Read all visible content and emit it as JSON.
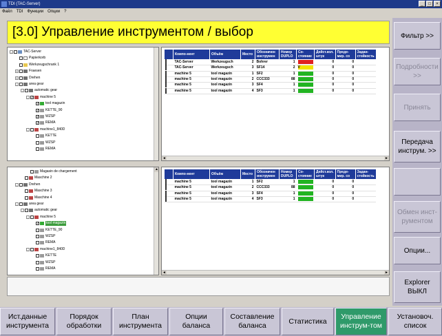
{
  "window": {
    "title": "TDI  (TAC-Server)"
  },
  "menu": [
    "Файл",
    "TDI",
    "Функции",
    "Опции",
    "?"
  ],
  "header": {
    "title": "[3.0] Управление инструментом / выбор"
  },
  "right_buttons": [
    {
      "label": "Фильтр >>",
      "enabled": true
    },
    {
      "label": "Подробности\n>>",
      "enabled": false
    },
    {
      "label": "Принять",
      "enabled": false
    },
    {
      "label": "Передача\nинструм. >>",
      "enabled": true
    },
    {
      "label": "",
      "enabled": false
    },
    {
      "label": "Обмен инст-\nрументом",
      "enabled": false
    },
    {
      "label": "Опции...",
      "enabled": true
    },
    {
      "label": "Explorer\nВЫКЛ",
      "enabled": true
    }
  ],
  "tree_top": [
    {
      "indent": 0,
      "exp": "-",
      "chk": "",
      "icon": "server",
      "label": "TAC-Server"
    },
    {
      "indent": 1,
      "exp": "",
      "chk": "",
      "icon": "doc",
      "label": "Papierkorb"
    },
    {
      "indent": 1,
      "exp": "",
      "chk": "",
      "icon": "folder",
      "label": "Werkzeugschrank 1"
    },
    {
      "indent": 1,
      "exp": "+",
      "chk": "",
      "icon": "gear",
      "label": "Fraesen"
    },
    {
      "indent": 1,
      "exp": "+",
      "chk": "",
      "icon": "gear",
      "label": "Drehen"
    },
    {
      "indent": 1,
      "exp": "-",
      "chk": "",
      "icon": "gear",
      "label": "area gear"
    },
    {
      "indent": 2,
      "exp": "-",
      "chk": "",
      "icon": "gear",
      "label": "automatic gear"
    },
    {
      "indent": 3,
      "exp": "-",
      "chk": "✓",
      "icon": "machine",
      "label": "machine 5"
    },
    {
      "indent": 4,
      "exp": "",
      "chk": "✓",
      "icon": "green",
      "label": "tool magazin"
    },
    {
      "indent": 4,
      "exp": "",
      "chk": "✓",
      "icon": "grey",
      "label": "KETTE_90"
    },
    {
      "indent": 4,
      "exp": "",
      "chk": "✓",
      "icon": "grey",
      "label": "WZSP"
    },
    {
      "indent": 4,
      "exp": "",
      "chk": "✓",
      "icon": "grey",
      "label": "REMA"
    },
    {
      "indent": 3,
      "exp": "-",
      "chk": "",
      "icon": "machine",
      "label": "machine1_840D"
    },
    {
      "indent": 4,
      "exp": "",
      "chk": "",
      "icon": "grey",
      "label": "KETTE"
    },
    {
      "indent": 4,
      "exp": "",
      "chk": "",
      "icon": "grey",
      "label": "WZSP"
    },
    {
      "indent": 4,
      "exp": "",
      "chk": "",
      "icon": "grey",
      "label": "REMA"
    }
  ],
  "tree_bottom": [
    {
      "indent": 3,
      "exp": "",
      "chk": "",
      "icon": "grey",
      "label": "Magasin de chargement"
    },
    {
      "indent": 2,
      "exp": "",
      "chk": "",
      "icon": "machine",
      "label": "Maschine 2"
    },
    {
      "indent": 1,
      "exp": "-",
      "chk": "",
      "icon": "gear",
      "label": "Drehen"
    },
    {
      "indent": 2,
      "exp": "",
      "chk": "",
      "icon": "machine",
      "label": "Maschine 3"
    },
    {
      "indent": 2,
      "exp": "",
      "chk": "",
      "icon": "machine",
      "label": "Maschine 4"
    },
    {
      "indent": 1,
      "exp": "-",
      "chk": "",
      "icon": "gear",
      "label": "area gear"
    },
    {
      "indent": 2,
      "exp": "-",
      "chk": "",
      "icon": "gear",
      "label": "automatic gear"
    },
    {
      "indent": 3,
      "exp": "-",
      "chk": "",
      "icon": "machine",
      "label": "machine 5"
    },
    {
      "indent": 4,
      "exp": "",
      "chk": "✓",
      "icon": "green",
      "label": "tool magazin",
      "selected": true
    },
    {
      "indent": 4,
      "exp": "",
      "chk": "",
      "icon": "grey",
      "label": "KETTE_90"
    },
    {
      "indent": 4,
      "exp": "",
      "chk": "",
      "icon": "grey",
      "label": "WZSP"
    },
    {
      "indent": 4,
      "exp": "",
      "chk": "",
      "icon": "grey",
      "label": "REMA"
    },
    {
      "indent": 3,
      "exp": "-",
      "chk": "",
      "icon": "machine",
      "label": "machine1_840D"
    },
    {
      "indent": 4,
      "exp": "",
      "chk": "",
      "icon": "grey",
      "label": "KETTE"
    },
    {
      "indent": 4,
      "exp": "",
      "chk": "",
      "icon": "grey",
      "label": "WZSP"
    },
    {
      "indent": 4,
      "exp": "",
      "chk": "",
      "icon": "grey",
      "label": "REMA"
    }
  ],
  "grid_headers": [
    "Компо-нент",
    "Объём",
    "Место",
    "Обозначен инструмен",
    "Номер DUPLO",
    "Со-стояние",
    "Дейст.кол. штук",
    "Преде-мир. со",
    "Задан-стойкость"
  ],
  "grid_top_rows": [
    {
      "comp": "TAC-Server",
      "vol": "Werkzeugsch",
      "place": "2",
      "name": "Bohrer",
      "duplo": "1",
      "status": "red",
      "status_text": "",
      "count": "0",
      "pre": "0"
    },
    {
      "comp": "TAC-Server",
      "vol": "Werkzeugsch",
      "place": "3",
      "name": "SF14",
      "duplo": "2",
      "status": "yellow",
      "status_text": "V",
      "count": "0",
      "pre": "0"
    },
    {
      "comp": "machine 5",
      "vol": "tool magazin",
      "place": "1",
      "name": "SF2",
      "duplo": "1",
      "status": "green",
      "status_text": "",
      "count": "0",
      "pre": "0"
    },
    {
      "comp": "machine 5",
      "vol": "tool magazin",
      "place": "2",
      "name": "CCC333",
      "duplo": "88",
      "status": "green",
      "status_text": "",
      "count": "0",
      "pre": "0"
    },
    {
      "comp": "machine 5",
      "vol": "tool magazin",
      "place": "3",
      "name": "SF4",
      "duplo": "1",
      "status": "green",
      "status_text": "",
      "count": "0",
      "pre": "0"
    },
    {
      "comp": "machine 5",
      "vol": "tool magazin",
      "place": "4",
      "name": "SF3",
      "duplo": "1",
      "status": "green",
      "status_text": "",
      "count": "0",
      "pre": "0"
    }
  ],
  "grid_bottom_rows": [
    {
      "comp": "machine 5",
      "vol": "tool magazin",
      "place": "1",
      "name": "SF2",
      "duplo": "1",
      "status": "green",
      "status_text": "",
      "count": "0",
      "pre": "0"
    },
    {
      "comp": "machine 5",
      "vol": "tool magazin",
      "place": "2",
      "name": "CCC333",
      "duplo": "88",
      "status": "green",
      "status_text": "",
      "count": "0",
      "pre": "0"
    },
    {
      "comp": "machine 5",
      "vol": "tool magazin",
      "place": "3",
      "name": "SF4",
      "duplo": "1",
      "status": "green",
      "status_text": "",
      "count": "0",
      "pre": "0"
    },
    {
      "comp": "machine 5",
      "vol": "tool magazin",
      "place": "4",
      "name": "SF3",
      "duplo": "1",
      "status": "green",
      "status_text": "",
      "count": "0",
      "pre": "0"
    }
  ],
  "status_colors": {
    "red": "#e02020",
    "yellow": "#f2e400",
    "green": "#22b422"
  },
  "bottom_buttons": [
    {
      "label": "Ист.данные\nинструмента",
      "active": false
    },
    {
      "label": "Порядок\nобработки",
      "active": false
    },
    {
      "label": "План\nинструмента",
      "active": false
    },
    {
      "label": "Опции\nбаланса",
      "active": false
    },
    {
      "label": "Составление\nбаланса",
      "active": false
    },
    {
      "label": "Статистика",
      "active": false
    },
    {
      "label": "Управление\nинструм-том",
      "active": true
    },
    {
      "label": "Установоч.\nсписок",
      "active": false
    }
  ]
}
